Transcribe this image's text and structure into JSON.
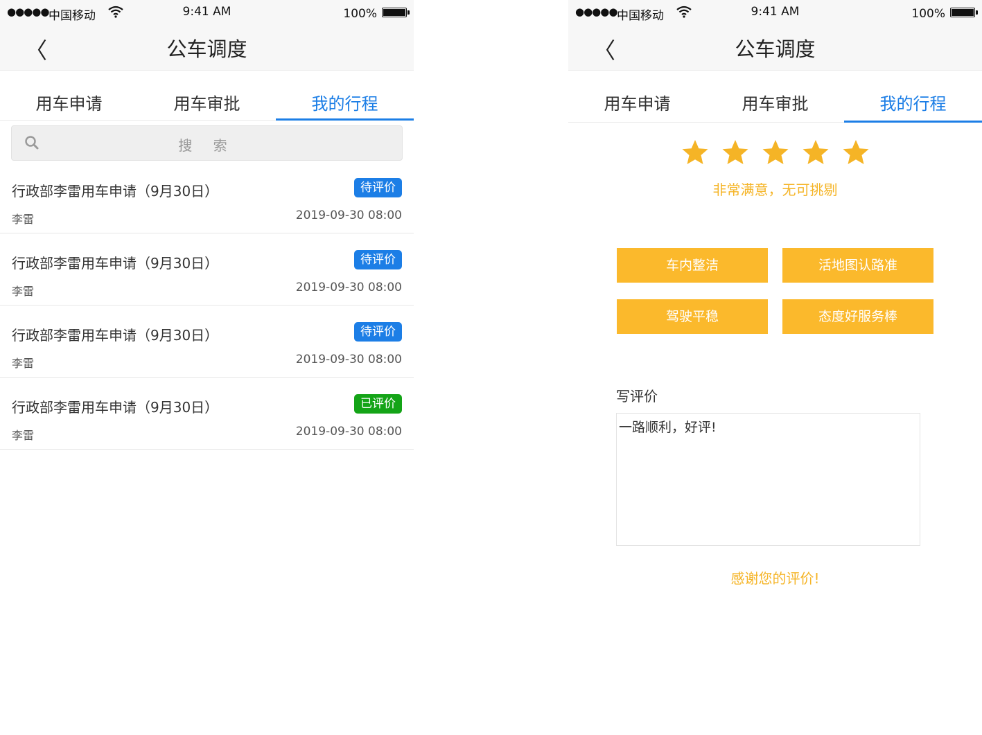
{
  "status": {
    "signal": "●●●●●",
    "carrier": "中国移动",
    "time": "9:41 AM",
    "battery": "100%"
  },
  "nav": {
    "back": "〈",
    "title": "公车调度"
  },
  "tabs": [
    {
      "label": "用车申请"
    },
    {
      "label": "用车审批"
    },
    {
      "label": "我的行程"
    }
  ],
  "search": {
    "placeholder": "搜 索"
  },
  "trips": [
    {
      "title": "行政部李雷用车申请（9月30日）",
      "status": "待评价",
      "person": "李雷",
      "datetime": "2019-09-30 08:00"
    },
    {
      "title": "行政部李雷用车申请（9月30日）",
      "status": "待评价",
      "person": "李雷",
      "datetime": "2019-09-30 08:00"
    },
    {
      "title": "行政部李雷用车申请（9月30日）",
      "status": "待评价",
      "person": "李雷",
      "datetime": "2019-09-30 08:00"
    },
    {
      "title": "行政部李雷用车申请（9月30日）",
      "status": "已评价",
      "person": "李雷",
      "datetime": "2019-09-30 08:00"
    }
  ],
  "review": {
    "rating": 5,
    "rating_text": "非常满意，无可挑剔",
    "tags": [
      "车内整洁",
      "活地图认路准",
      "驾驶平稳",
      "态度好服务棒"
    ],
    "write_label": "写评价",
    "comment": "一路顺利，好评!",
    "thanks": "感谢您的评价!"
  },
  "colors": {
    "accent": "#1c7ee6",
    "pending": "#1c7ee6",
    "done": "#14a417",
    "star": "#f5b426",
    "tag": "#fbb92c"
  }
}
